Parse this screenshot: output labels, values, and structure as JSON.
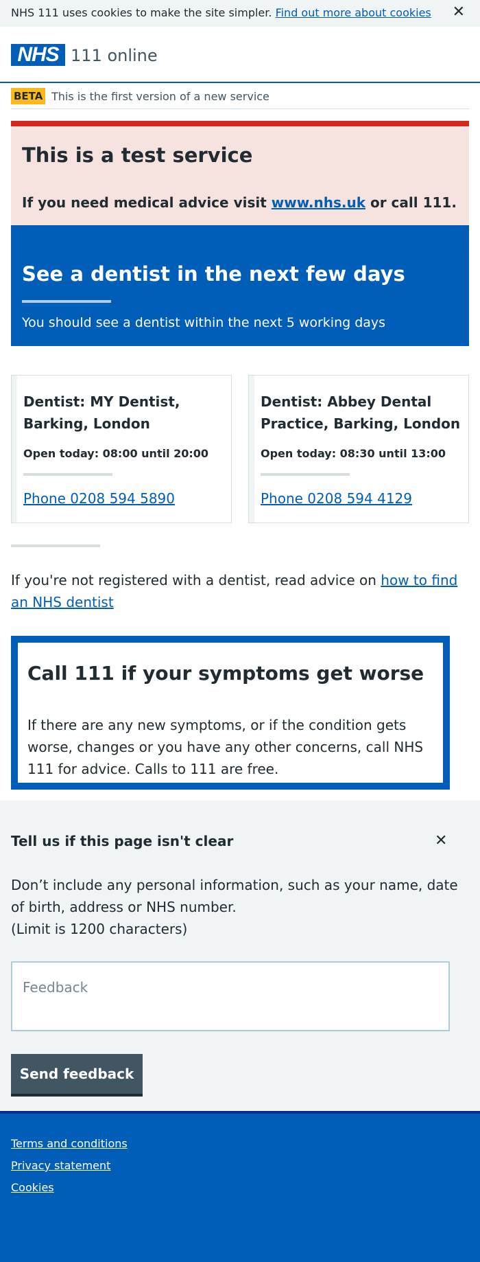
{
  "cookie_banner": {
    "text": "NHS 111 uses cookies to make the site simpler.",
    "link": "Find out more about cookies",
    "close": "✕"
  },
  "header": {
    "logo": "NHS",
    "service": "111 online"
  },
  "beta": {
    "tag": "BETA",
    "text": "This is the first version of a new service"
  },
  "test_notice": {
    "title": "This is a test service",
    "body_before": "If you need medical advice visit ",
    "link": "www.nhs.uk",
    "body_after": " or call 111."
  },
  "hero": {
    "title": "See a dentist in the next few days",
    "subtitle": "You should see a dentist within the next 5 working days"
  },
  "services": [
    {
      "name": "Dentist: MY Dentist, Barking, London",
      "opening": "Open today: 08:00 until 20:00",
      "phone": "Phone 0208 594 5890"
    },
    {
      "name": "Dentist: Abbey Dental Practice, Barking, London",
      "opening": "Open today: 08:30 until 13:00",
      "phone": "Phone 0208 594 4129"
    }
  ],
  "advice": {
    "text": "If you're not registered with a dentist, read advice on ",
    "link": "how to find an NHS dentist"
  },
  "call_box": {
    "title": "Call 111 if your symptoms get worse",
    "body": "If there are any new symptoms, or if the condition gets worse, changes or you have any other concerns, call NHS 111 for advice. Calls to 111 are free."
  },
  "feedback": {
    "title": "Tell us if this page isn't clear",
    "close": "✕",
    "text": "Don’t include any personal information, such as your name, date of birth, address or NHS number.",
    "limit": "(Limit is 1200 characters)",
    "placeholder": "Feedback",
    "button": "Send feedback"
  },
  "footer": {
    "links": [
      "Terms and conditions",
      "Privacy statement",
      "Cookies"
    ]
  },
  "colors": {
    "nhs_blue": "#005eb8",
    "warning_red": "#d5281b",
    "beta_yellow": "#ffb81c",
    "grey_bg": "#f0f4f5"
  }
}
